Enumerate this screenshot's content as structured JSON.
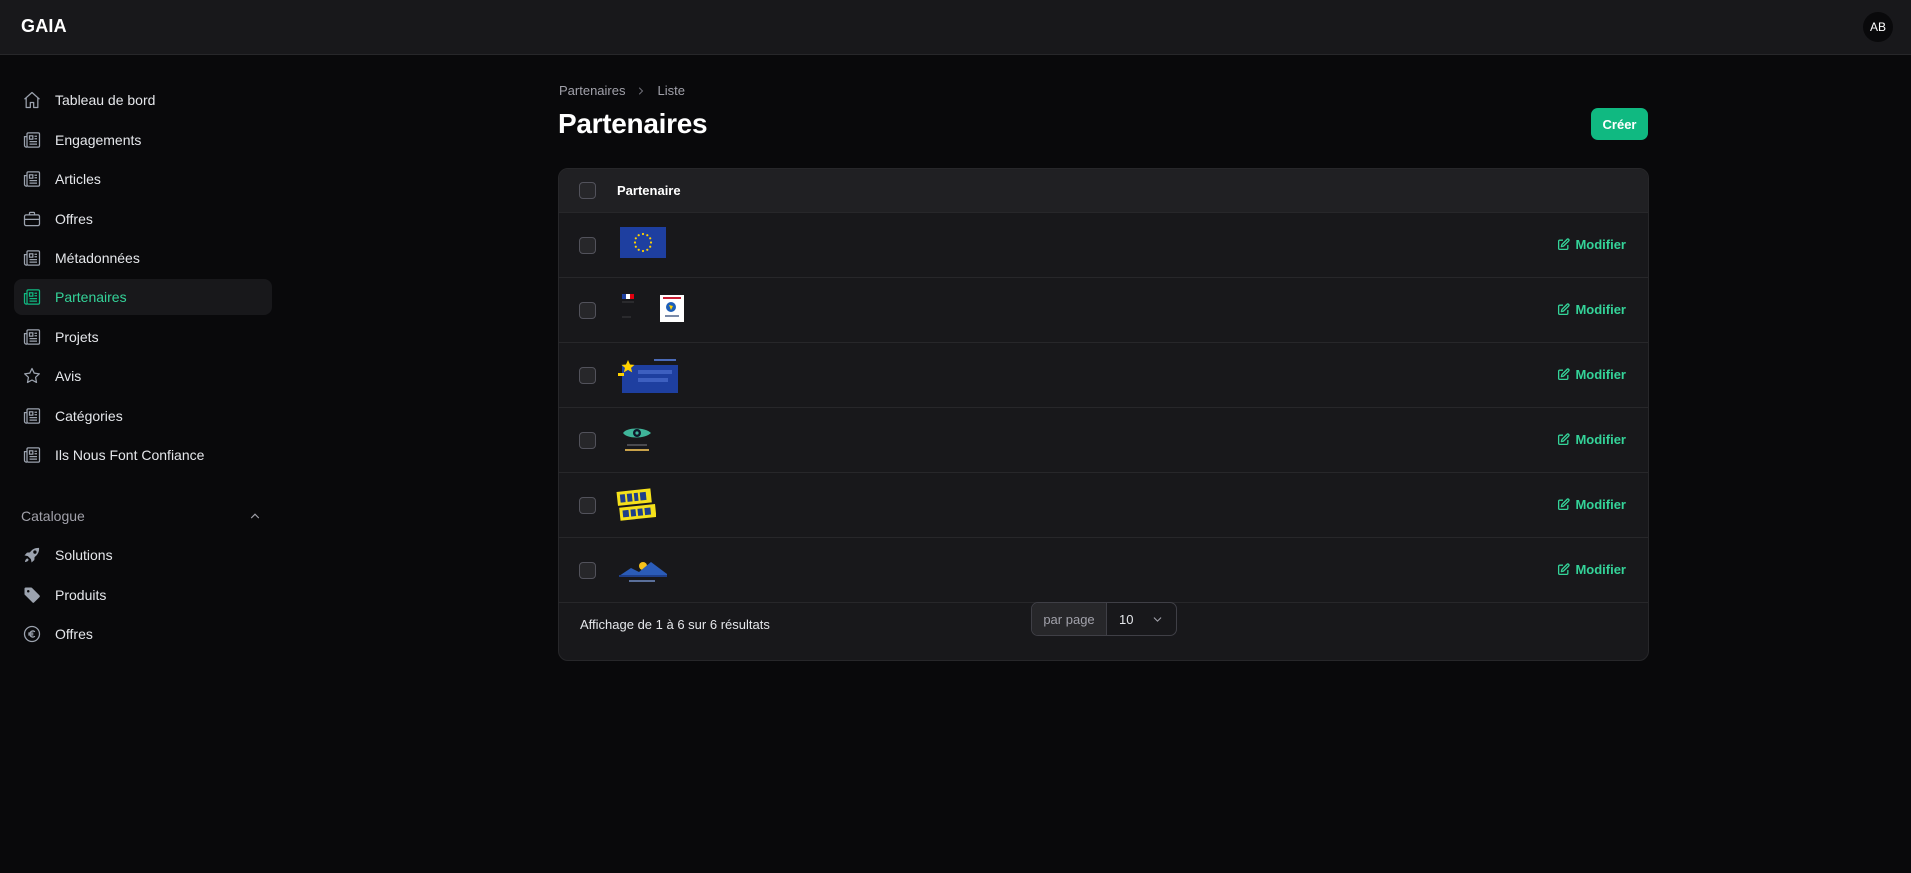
{
  "app": {
    "name": "GAIA",
    "user_initials": "AB"
  },
  "sidebar": {
    "items": [
      {
        "label": "Tableau de bord",
        "icon": "home-icon"
      },
      {
        "label": "Engagements",
        "icon": "newspaper-icon"
      },
      {
        "label": "Articles",
        "icon": "newspaper-icon"
      },
      {
        "label": "Offres",
        "icon": "briefcase-icon"
      },
      {
        "label": "Métadonnées",
        "icon": "newspaper-icon"
      },
      {
        "label": "Partenaires",
        "icon": "newspaper-icon",
        "active": true
      },
      {
        "label": "Projets",
        "icon": "newspaper-icon"
      },
      {
        "label": "Avis",
        "icon": "star-icon"
      },
      {
        "label": "Catégories",
        "icon": "newspaper-icon"
      },
      {
        "label": "Ils Nous Font Confiance",
        "icon": "newspaper-icon"
      }
    ],
    "group": {
      "label": "Catalogue",
      "expanded": true,
      "items": [
        {
          "label": "Solutions",
          "icon": "rocket-icon"
        },
        {
          "label": "Produits",
          "icon": "tag-icon"
        },
        {
          "label": "Offres",
          "icon": "euro-icon"
        }
      ]
    }
  },
  "breadcrumb": {
    "parent": "Partenaires",
    "current": "Liste"
  },
  "page": {
    "title": "Partenaires",
    "create_label": "Créer"
  },
  "table": {
    "column": "Partenaire",
    "action_label": "Modifier",
    "rows": [
      {
        "logo": "european-union-flag-logo"
      },
      {
        "logo": "republique-francaise-and-region-logo"
      },
      {
        "logo": "europe-sengage-logo"
      },
      {
        "logo": "eye-reunion-logo"
      },
      {
        "logo": "agir-plus-logo"
      },
      {
        "logo": "mountain-sun-logo"
      }
    ]
  },
  "footer": {
    "result_text": "Affichage de 1 à 6 sur 6 résultats",
    "per_page_label": "par page",
    "per_page_value": "10"
  },
  "colors": {
    "accent": "#10b981",
    "accent_text": "#34d399",
    "background": "#09090b",
    "surface": "#18181b"
  }
}
